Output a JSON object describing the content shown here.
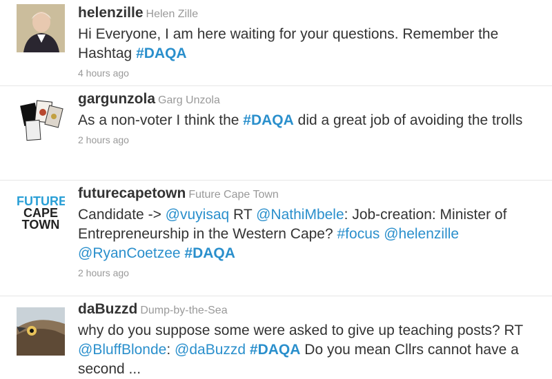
{
  "tweets": [
    {
      "avatar_icon": "helenzille-avatar",
      "screen_name": "helenzille",
      "full_name": "Helen Zille",
      "text_parts": [
        "Hi Everyone, I am here waiting for your questions. Remember the Hashtag ",
        "#DAQA"
      ],
      "time": "4 hours ago"
    },
    {
      "avatar_icon": "gargunzola-avatar",
      "screen_name": "gargunzola",
      "full_name": "Garg Unzola",
      "text_parts": [
        "As a non-voter I think the ",
        "#DAQA",
        " did a great job of avoiding the trolls"
      ],
      "time": "2 hours ago"
    },
    {
      "avatar_icon": "futurecapetown-avatar",
      "avatar_text": [
        "FUTURE",
        "CAPE",
        "TOWN"
      ],
      "screen_name": "futurecapetown",
      "full_name": "Future Cape Town",
      "text_parts": [
        "Candidate -> ",
        "@vuyisaq",
        " RT ",
        "@NathiMbele",
        ": Job-creation: Minister of Entrepreneurship in the Western Cape? ",
        "#focus",
        " ",
        "@helenzille",
        " ",
        "@RyanCoetzee",
        " ",
        "#DAQA"
      ],
      "time": "2 hours ago"
    },
    {
      "avatar_icon": "dabuzzd-avatar",
      "screen_name": "daBuzzd",
      "full_name": "Dump-by-the-Sea",
      "text_parts": [
        "why do you suppose some were asked to give up teaching posts? RT ",
        "@BluffBlonde",
        ": ",
        "@daBuzzd",
        " ",
        "#DAQA",
        " Do you mean Cllrs cannot have a second ..."
      ]
    }
  ],
  "colors": {
    "link": "#2a8fcc",
    "text": "#333333",
    "meta": "#999999",
    "divider": "#e6e6e6"
  }
}
